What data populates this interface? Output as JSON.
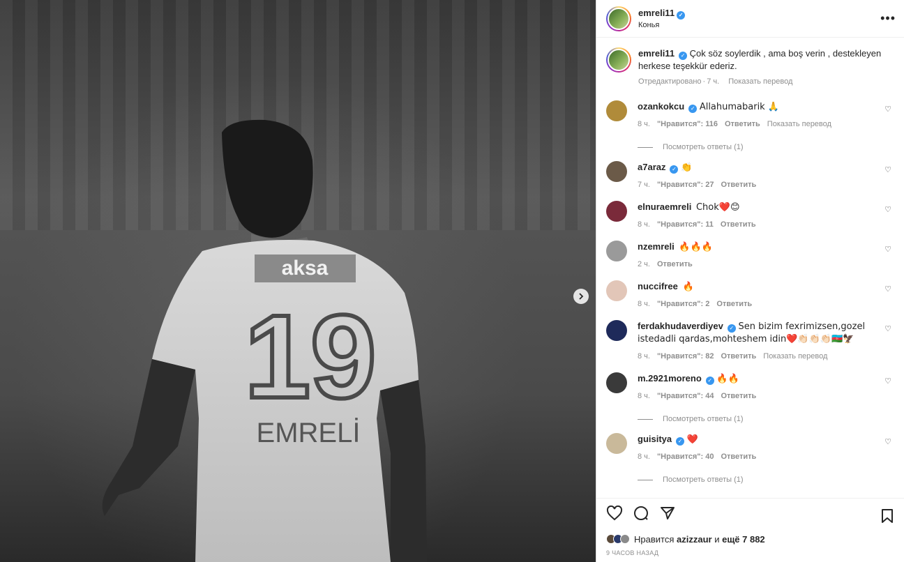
{
  "post": {
    "author": "emreli11",
    "location": "Конья",
    "caption": "Çok söz soylerdik , ama boş verin , destekleyen herkese teşekkür ederiz.",
    "caption_meta": {
      "edited": "Отредактировано",
      "time": "7 ч.",
      "translate": "Показать перевод"
    },
    "image": {
      "jersey_sponsor": "aksa",
      "jersey_number": "19",
      "jersey_name": "EMRELİ"
    }
  },
  "comments": [
    {
      "user": "ozankokcu",
      "verified": true,
      "text": "Allahumabarik 🙏",
      "time": "8 ч.",
      "likes": "\"Нравится\": 116",
      "reply": "Ответить",
      "translate": "Показать перевод",
      "replies": "Посмотреть ответы (1)",
      "avatar_color": "#b08b3a"
    },
    {
      "user": "a7araz",
      "verified": true,
      "text": "👏",
      "time": "7 ч.",
      "likes": "\"Нравится\": 27",
      "reply": "Ответить",
      "avatar_color": "#6b5a48"
    },
    {
      "user": "elnuraemreli",
      "verified": false,
      "text": "Chok❤️😊",
      "time": "8 ч.",
      "likes": "\"Нравится\": 11",
      "reply": "Ответить",
      "avatar_color": "#7a2a3a"
    },
    {
      "user": "nzemreli",
      "verified": false,
      "text": "🔥🔥🔥",
      "time": "2 ч.",
      "likes": "",
      "reply": "Ответить",
      "avatar_color": "#9a9a9a"
    },
    {
      "user": "nuccifree",
      "verified": false,
      "text": "🔥",
      "time": "8 ч.",
      "likes": "\"Нравится\": 2",
      "reply": "Ответить",
      "avatar_color": "#e2c6b8"
    },
    {
      "user": "ferdakhudaverdiyev",
      "verified": true,
      "text": "Sen bizim fexrimizsen,gozel istedadli qardas,mohteshem idin❤️👏🏻👏🏻👏🏻🇦🇿🦅",
      "time": "8 ч.",
      "likes": "\"Нравится\": 82",
      "reply": "Ответить",
      "translate": "Показать перевод",
      "avatar_color": "#1e2a5a"
    },
    {
      "user": "m.2921moreno",
      "verified": true,
      "text": "🔥🔥",
      "time": "8 ч.",
      "likes": "\"Нравится\": 44",
      "reply": "Ответить",
      "replies": "Посмотреть ответы (1)",
      "avatar_color": "#3a3a3a"
    },
    {
      "user": "guisitya",
      "verified": true,
      "text": "❤️",
      "time": "8 ч.",
      "likes": "\"Нравится\": 40",
      "reply": "Ответить",
      "replies": "Посмотреть ответы (1)",
      "avatar_color": "#c9b99a"
    }
  ],
  "likes_line": {
    "prefix": "Нравится",
    "user": "azizzaur",
    "mid": "и",
    "count": "ещё 7 882"
  },
  "posted_ago": "9 ЧАСОВ НАЗАД",
  "icons": [
    "more-icon",
    "heart-icon",
    "comment-icon",
    "share-icon",
    "save-icon",
    "next-arrow-icon",
    "verified-icon"
  ]
}
